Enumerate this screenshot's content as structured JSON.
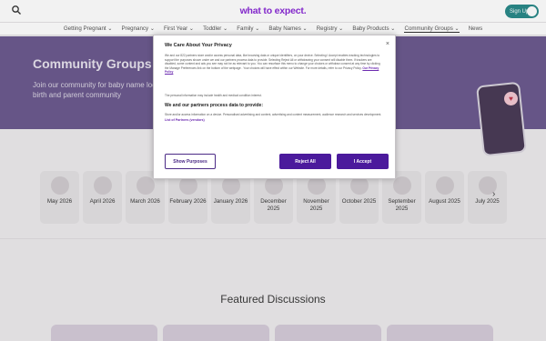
{
  "header": {
    "logo": "what to expect.",
    "signup_label": "Sign Up",
    "search_icon": "search-icon",
    "avatar_icon": "user-avatar-icon"
  },
  "nav": {
    "items": [
      {
        "label": "Getting Pregnant ⌄"
      },
      {
        "label": "Pregnancy ⌄"
      },
      {
        "label": "First Year ⌄"
      },
      {
        "label": "Toddler ⌄"
      },
      {
        "label": "Family ⌄"
      },
      {
        "label": "Baby Names ⌄"
      },
      {
        "label": "Registry ⌄"
      },
      {
        "label": "Baby Products ⌄"
      },
      {
        "label": "Community Groups ⌄"
      },
      {
        "label": "News"
      }
    ]
  },
  "hero": {
    "title": "Community Groups",
    "subtitle": "Join our community for baby name local birth and parent community"
  },
  "months": [
    {
      "label": "May 2026"
    },
    {
      "label": "April 2026"
    },
    {
      "label": "March 2026"
    },
    {
      "label": "February 2026"
    },
    {
      "label": "January 2026"
    },
    {
      "label": "December 2025"
    },
    {
      "label": "November 2025"
    },
    {
      "label": "October 2025"
    },
    {
      "label": "September 2025"
    },
    {
      "label": "August 2025"
    },
    {
      "label": "July 2025"
    }
  ],
  "featured": {
    "title": "Featured Discussions"
  },
  "modal": {
    "title": "We Care About Your Privacy",
    "body": "We and our 822 partners store and/or access personal data, like browsing data or unique identifiers, on your device. Selecting I Accept enables tracking technologies to support the purposes shown under we and our partners process data to provide. Selecting Reject All or withdrawing your consent will disable them. If trackers are disabled, some content and ads you see may not be as relevant to you. You can resurface this menu to change your choices or withdraw consent at any time by clicking the Manage Preferences link on the bottom of the webpage . Your choices will have effect within our Website. For more details, refer to our Privacy Policy.",
    "privacy_link": "Our Privacy Policy",
    "legit": "The personal information may include health and medical condition interest.",
    "process_title": "We and our partners process data to provide:",
    "process_body": "Store and/or access information on a device. Personalised advertising and content, advertising and content measurement, audience research and services development.",
    "partners_link": "List of Partners (vendors)",
    "buttons": {
      "show": "Show Purposes",
      "reject": "Reject All",
      "accept": "I Accept"
    }
  }
}
